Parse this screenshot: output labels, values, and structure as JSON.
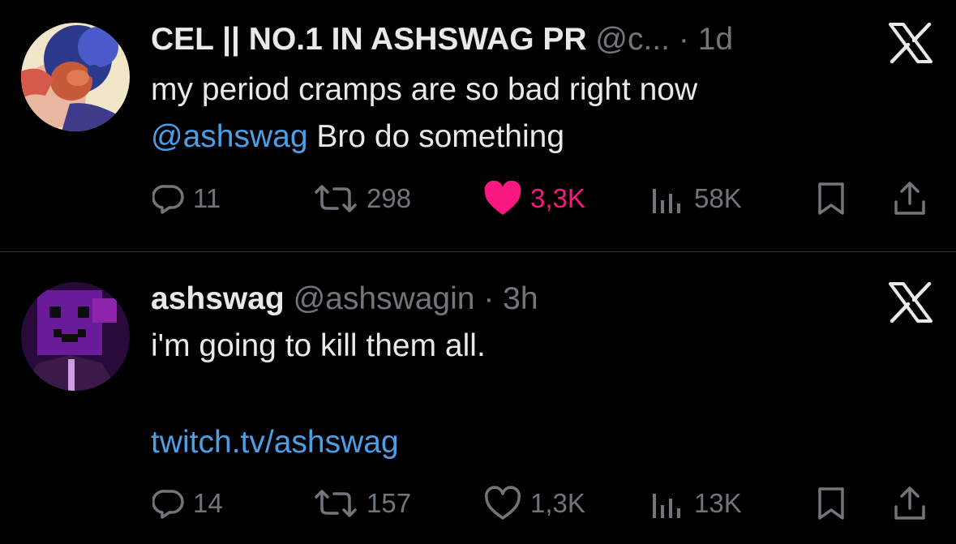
{
  "tweets": [
    {
      "author_name": "CEL || NO.1 IN ASHSWAG PR",
      "handle": "@c...",
      "separator": "·",
      "time": "1d",
      "text_line1": "my period cramps are so bad right now",
      "mention": "@ashswag",
      "text_line2_rest": " Bro do something",
      "replies": "11",
      "retweets": "298",
      "likes": "3,3K",
      "liked": true,
      "views": "58K",
      "avatar_icon": "avatar-illustrated-character"
    },
    {
      "author_name": "ashswag",
      "handle": "@ashswagin",
      "separator": "·",
      "time": "3h",
      "text_line1": "i'm going to kill them all.",
      "link": "twitch.tv/ashswag",
      "replies": "14",
      "retweets": "157",
      "likes": "1,3K",
      "liked": false,
      "views": "13K",
      "avatar_icon": "avatar-purple-pixel-character"
    }
  ],
  "colors": {
    "background": "#000000",
    "text": "#e7e9ea",
    "secondary": "#71767b",
    "link": "#4b9fe6",
    "like": "#f91880",
    "divider": "#2f3336"
  },
  "icons": [
    "x-logo-icon",
    "reply-icon",
    "retweet-icon",
    "like-icon",
    "views-icon",
    "bookmark-icon",
    "share-icon"
  ]
}
